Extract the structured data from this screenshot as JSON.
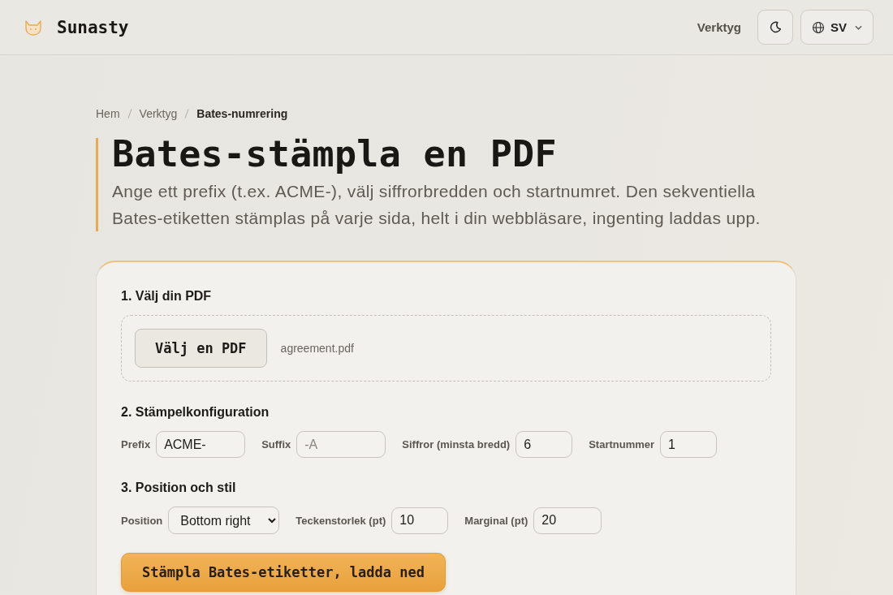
{
  "header": {
    "brand": "Sunasty",
    "nav_link": "Verktyg",
    "language": "SV"
  },
  "breadcrumb": [
    {
      "label": "Hem",
      "current": false
    },
    {
      "label": "Verktyg",
      "current": false
    },
    {
      "label": "Bates-numrering",
      "current": true
    }
  ],
  "page": {
    "title": "Bates-stämpla en PDF",
    "description": "Ange ett prefix (t.ex. ACME-), välj siffrorbredden och startnumret. Den sekventiella Bates-etiketten stämplas på varje sida, helt i din webbläsare, ingenting laddas upp."
  },
  "sections": [
    {
      "kind": "file",
      "heading": "1. Välj din PDF",
      "button": "Välj en PDF",
      "file_name": "agreement.pdf"
    },
    {
      "kind": "fields",
      "heading": "2. Stämpelkonfiguration",
      "fields": [
        {
          "kind": "text",
          "label": "Prefix",
          "value": "ACME-"
        },
        {
          "kind": "text",
          "label": "Suffix",
          "placeholder": "-A"
        },
        {
          "kind": "number",
          "label": "Siffror (minsta bredd)",
          "value": "6"
        },
        {
          "kind": "number",
          "label": "Startnummer",
          "value": "1"
        }
      ]
    },
    {
      "kind": "fields",
      "heading": "3. Position och stil",
      "fields": [
        {
          "kind": "select",
          "label": "Position",
          "value": "Bottom right"
        },
        {
          "kind": "number",
          "label": "Teckenstorlek (pt)",
          "value": "10"
        },
        {
          "kind": "number",
          "label": "Marginal (pt)",
          "value": "20"
        }
      ]
    }
  ],
  "submit_button": "Stämpla Bates-etiketter, ladda ned"
}
